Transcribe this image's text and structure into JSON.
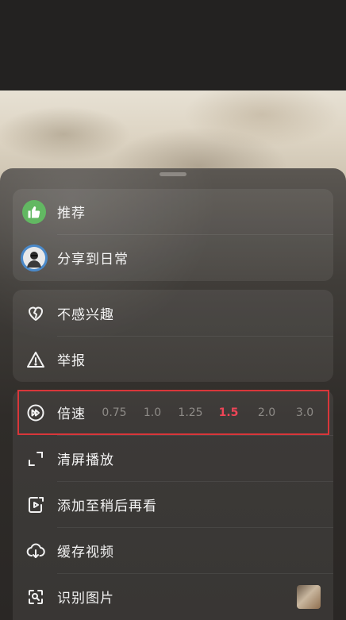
{
  "menu": {
    "recommend_label": "推荐",
    "share_label": "分享到日常",
    "not_interested_label": "不感兴趣",
    "report_label": "举报",
    "speed_label": "倍速",
    "speed_options": [
      "0.75",
      "1.0",
      "1.25",
      "1.5",
      "2.0",
      "3.0"
    ],
    "speed_selected": "1.5",
    "clear_screen_label": "清屏播放",
    "watch_later_label": "添加至稍后再看",
    "cache_label": "缓存视频",
    "recognize_label": "识别图片"
  },
  "colors": {
    "accent": "#ef4557",
    "recommend_badge": "#62b862",
    "highlight_box": "#d9363a"
  },
  "icons": {
    "recommend": "thumbs-up-icon",
    "share": "avatar",
    "not_interested": "broken-heart-icon",
    "report": "warning-icon",
    "speed": "fast-forward-icon",
    "clear_screen": "fullscreen-corners-icon",
    "watch_later": "play-later-icon",
    "cache": "cloud-download-icon",
    "recognize": "scan-image-icon"
  }
}
